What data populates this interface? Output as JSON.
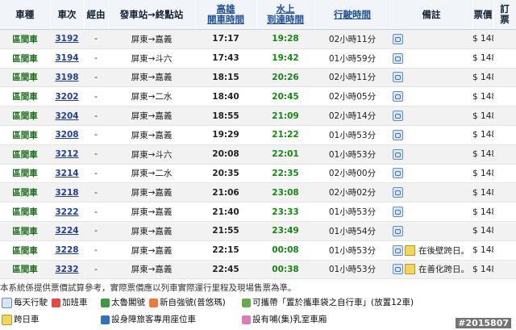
{
  "headers": {
    "type": "車種",
    "number": "車次",
    "via": "經由",
    "route": "發車站→終點站",
    "depart_l1": "高雄",
    "depart_l2": "開車時間",
    "arrive_l1": "水上",
    "arrive_l2": "到達時間",
    "duration": "行駛時間",
    "note": "備註",
    "price": "票價",
    "order_l1": "訂",
    "order_l2": "票"
  },
  "rows": [
    {
      "type": "區間車",
      "number": "3192",
      "via": "-",
      "route": "屏東→嘉義",
      "dep": "17:17",
      "arr": "19:28",
      "dur": "02小時11分",
      "note": "",
      "price": "$ 148"
    },
    {
      "type": "區間車",
      "number": "3194",
      "via": "-",
      "route": "屏東→斗六",
      "dep": "17:43",
      "arr": "19:42",
      "dur": "01小時59分",
      "note": "",
      "price": "$ 148"
    },
    {
      "type": "區間車",
      "number": "3198",
      "via": "-",
      "route": "屏東→嘉義",
      "dep": "18:15",
      "arr": "20:26",
      "dur": "02小時11分",
      "note": "",
      "price": "$ 148"
    },
    {
      "type": "區間車",
      "number": "3202",
      "via": "-",
      "route": "屏東→二水",
      "dep": "18:40",
      "arr": "20:45",
      "dur": "02小時05分",
      "note": "",
      "price": "$ 148"
    },
    {
      "type": "區間車",
      "number": "3204",
      "via": "-",
      "route": "屏東→嘉義",
      "dep": "18:55",
      "arr": "21:09",
      "dur": "02小時14分",
      "note": "",
      "price": "$ 148"
    },
    {
      "type": "區間車",
      "number": "3208",
      "via": "-",
      "route": "屏東→嘉義",
      "dep": "19:29",
      "arr": "21:22",
      "dur": "01小時53分",
      "note": "",
      "price": "$ 148"
    },
    {
      "type": "區間車",
      "number": "3212",
      "via": "-",
      "route": "屏東→斗六",
      "dep": "20:08",
      "arr": "22:01",
      "dur": "01小時53分",
      "note": "",
      "price": "$ 148"
    },
    {
      "type": "區間車",
      "number": "3214",
      "via": "-",
      "route": "屏東→二水",
      "dep": "20:35",
      "arr": "22:35",
      "dur": "02小時00分",
      "note": "",
      "price": "$ 148"
    },
    {
      "type": "區間車",
      "number": "3218",
      "via": "-",
      "route": "屏東→嘉義",
      "dep": "21:06",
      "arr": "23:08",
      "dur": "02小時02分",
      "note": "",
      "price": "$ 148"
    },
    {
      "type": "區間車",
      "number": "3222",
      "via": "-",
      "route": "屏東→嘉義",
      "dep": "21:40",
      "arr": "23:33",
      "dur": "01小時53分",
      "note": "",
      "price": "$ 148"
    },
    {
      "type": "區間車",
      "number": "3224",
      "via": "-",
      "route": "屏東→嘉義",
      "dep": "21:55",
      "arr": "23:49",
      "dur": "01小時54分",
      "note": "",
      "price": "$ 148"
    },
    {
      "type": "區間車",
      "number": "3228",
      "via": "-",
      "route": "屏東→嘉義",
      "dep": "22:15",
      "arr": "00:08",
      "dur": "01小時53分",
      "note": "在後壁跨日。",
      "price": "$ 148"
    },
    {
      "type": "區間車",
      "number": "3232",
      "via": "-",
      "route": "屏東→嘉義",
      "dep": "22:45",
      "arr": "00:38",
      "dur": "01小時53分",
      "note": "在善化跨日。",
      "price": "$ 148"
    }
  ],
  "disclaimer": "本系統係提供票價試算參考，實際票價應以列車實際運行里程及現場售票為準。",
  "legend": {
    "daily": "每天行駛",
    "extra": "加班車",
    "taroko": "太魯閣號",
    "tze": "新自強號(普悠瑪)",
    "bike": "可攜帶「置於攜車袋之自行車」(放置12車)",
    "cross_day": "跨日車",
    "disabled": "設身障旅客專用座位車",
    "nursing": "設有哺(集)乳室車廂"
  },
  "watermark": "#2015807",
  "colors": {
    "header_bg": "#f1f4f9",
    "type_green": "#1b6b1b",
    "arrive_green": "#118a11",
    "link_blue": "#1f3f9a"
  }
}
